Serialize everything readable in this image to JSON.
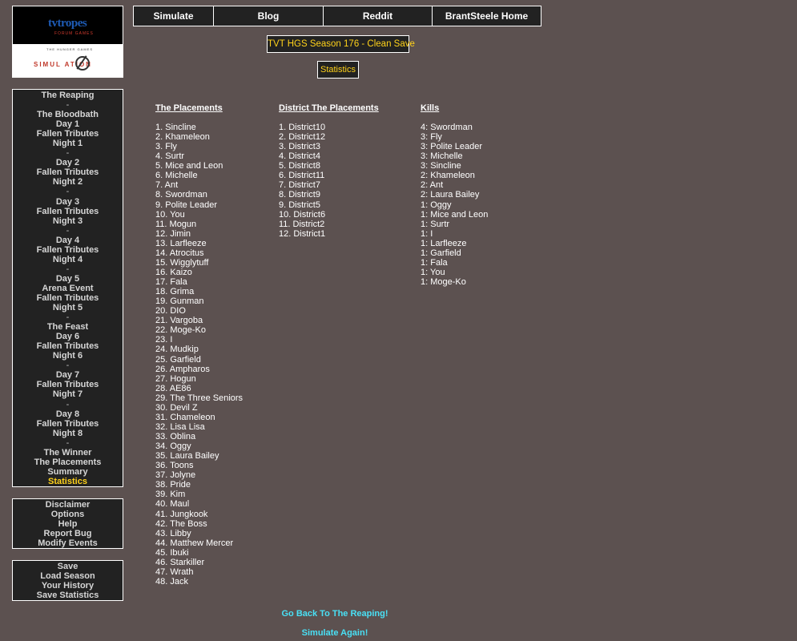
{
  "logo": {
    "top_text": "tvtropes",
    "top_sub": "FORUM GAMES",
    "bottom_small": "THE HUNGER GAMES",
    "bottom_text": "SIMUL ATION"
  },
  "topnav": [
    {
      "label": "Simulate"
    },
    {
      "label": "Blog"
    },
    {
      "label": "Reddit"
    },
    {
      "label": "BrantSteele Home"
    }
  ],
  "season_title": "TVT HGS Season 176 - Clean Save",
  "statistics_button": "Statistics",
  "sidebar_nav": [
    {
      "label": "The Reaping",
      "type": "link"
    },
    {
      "label": "-",
      "type": "sep"
    },
    {
      "label": "The Bloodbath",
      "type": "link"
    },
    {
      "label": "Day 1",
      "type": "link"
    },
    {
      "label": "Fallen Tributes",
      "type": "link"
    },
    {
      "label": "Night 1",
      "type": "link"
    },
    {
      "label": "-",
      "type": "sep"
    },
    {
      "label": "Day 2",
      "type": "link"
    },
    {
      "label": "Fallen Tributes",
      "type": "link"
    },
    {
      "label": "Night 2",
      "type": "link"
    },
    {
      "label": "-",
      "type": "sep"
    },
    {
      "label": "Day 3",
      "type": "link"
    },
    {
      "label": "Fallen Tributes",
      "type": "link"
    },
    {
      "label": "Night 3",
      "type": "link"
    },
    {
      "label": "-",
      "type": "sep"
    },
    {
      "label": "Day 4",
      "type": "link"
    },
    {
      "label": "Fallen Tributes",
      "type": "link"
    },
    {
      "label": "Night 4",
      "type": "link"
    },
    {
      "label": "-",
      "type": "sep"
    },
    {
      "label": "Day 5",
      "type": "link"
    },
    {
      "label": "Arena Event",
      "type": "link"
    },
    {
      "label": "Fallen Tributes",
      "type": "link"
    },
    {
      "label": "Night 5",
      "type": "link"
    },
    {
      "label": "-",
      "type": "sep"
    },
    {
      "label": "The Feast",
      "type": "link"
    },
    {
      "label": "Day 6",
      "type": "link"
    },
    {
      "label": "Fallen Tributes",
      "type": "link"
    },
    {
      "label": "Night 6",
      "type": "link"
    },
    {
      "label": "-",
      "type": "sep"
    },
    {
      "label": "Day 7",
      "type": "link"
    },
    {
      "label": "Fallen Tributes",
      "type": "link"
    },
    {
      "label": "Night 7",
      "type": "link"
    },
    {
      "label": "-",
      "type": "sep"
    },
    {
      "label": "Day 8",
      "type": "link"
    },
    {
      "label": "Fallen Tributes",
      "type": "link"
    },
    {
      "label": "Night 8",
      "type": "link"
    },
    {
      "label": "-",
      "type": "sep"
    },
    {
      "label": "The Winner",
      "type": "link"
    },
    {
      "label": "The Placements",
      "type": "link"
    },
    {
      "label": "Summary",
      "type": "link"
    },
    {
      "label": "Statistics",
      "type": "active"
    }
  ],
  "sidebar_info": [
    {
      "label": "Disclaimer"
    },
    {
      "label": "Options"
    },
    {
      "label": "Help"
    },
    {
      "label": "Report Bug"
    },
    {
      "label": "Modify Events"
    }
  ],
  "sidebar_save": [
    {
      "label": "Save"
    },
    {
      "label": "Load Season"
    },
    {
      "label": "Your History"
    },
    {
      "label": "Save Statistics"
    }
  ],
  "placements": {
    "header": "The Placements",
    "items": [
      "1. Sincline",
      "2. Khameleon",
      "3. Fly",
      "4. Surtr",
      "5. Mice and Leon",
      "6. Michelle",
      "7. Ant",
      "8. Swordman",
      "9. Polite Leader",
      "10. You",
      "11. Mogun",
      "12. Jimin",
      "13. Larfleeze",
      "14. Atrocitus",
      "15. Wigglytuff",
      "16. Kaizo",
      "17. Fala",
      "18. Grima",
      "19. Gunman",
      "20. DIO",
      "21. Vargoba",
      "22. Moge-Ko",
      "23. I",
      "24. Mudkip",
      "25. Garfield",
      "26. Ampharos",
      "27. Hogun",
      "28. AE86",
      "29. The Three Seniors",
      "30. Devil Z",
      "31. Chameleon",
      "32. Lisa Lisa",
      "33. Oblina",
      "34. Oggy",
      "35. Laura Bailey",
      "36. Toons",
      "37. Jolyne",
      "38. Pride",
      "39. Kim",
      "40. Maul",
      "41. Jungkook",
      "42. The Boss",
      "43. Libby",
      "44. Matthew Mercer",
      "45. Ibuki",
      "46. Starkiller",
      "47. Wrath",
      "48. Jack"
    ]
  },
  "district_placements": {
    "header": "District The Placements",
    "items": [
      "1. District10",
      "2. District12",
      "3. District3",
      "4. District4",
      "5. District8",
      "6. District11",
      "7. District7",
      "8. District9",
      "9. District5",
      "10. District6",
      "11. District2",
      "12. District1"
    ]
  },
  "kills": {
    "header": "Kills",
    "items": [
      "4: Swordman",
      "3: Fly",
      "3: Polite Leader",
      "3: Michelle",
      "3: Sincline",
      "2: Khameleon",
      "2: Ant",
      "2: Laura Bailey",
      "1: Oggy",
      "1: Mice and Leon",
      "1: Surtr",
      "1: I",
      "1: Larfleeze",
      "1: Garfield",
      "1: Fala",
      "1: You",
      "1: Moge-Ko"
    ]
  },
  "links": {
    "go_back": "Go Back To The Reaping!",
    "simulate_again": "Simulate Again!"
  },
  "colors": {
    "background": "#5c5150",
    "panel": "#222222",
    "highlight": "#ffd21a",
    "link": "#49e0f5"
  }
}
